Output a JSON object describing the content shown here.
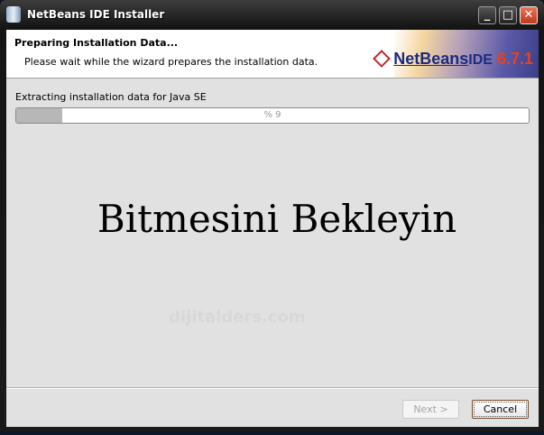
{
  "window": {
    "title": "NetBeans IDE Installer",
    "controls": [
      "minimize",
      "maximize",
      "close"
    ]
  },
  "header": {
    "title": "Preparing Installation Data...",
    "subtitle": "Please wait while the wizard prepares the installation data.",
    "logo": {
      "brand": "NetBeans",
      "product": "IDE",
      "version": "6.7.1"
    }
  },
  "progress": {
    "status": "Extracting installation data for Java SE",
    "percent": 9,
    "label": "% 9"
  },
  "overlay": {
    "caption": "Bitmesini Bekleyin",
    "watermark": "dijitalders.com"
  },
  "buttons": {
    "next": "Next >",
    "cancel": "Cancel"
  }
}
